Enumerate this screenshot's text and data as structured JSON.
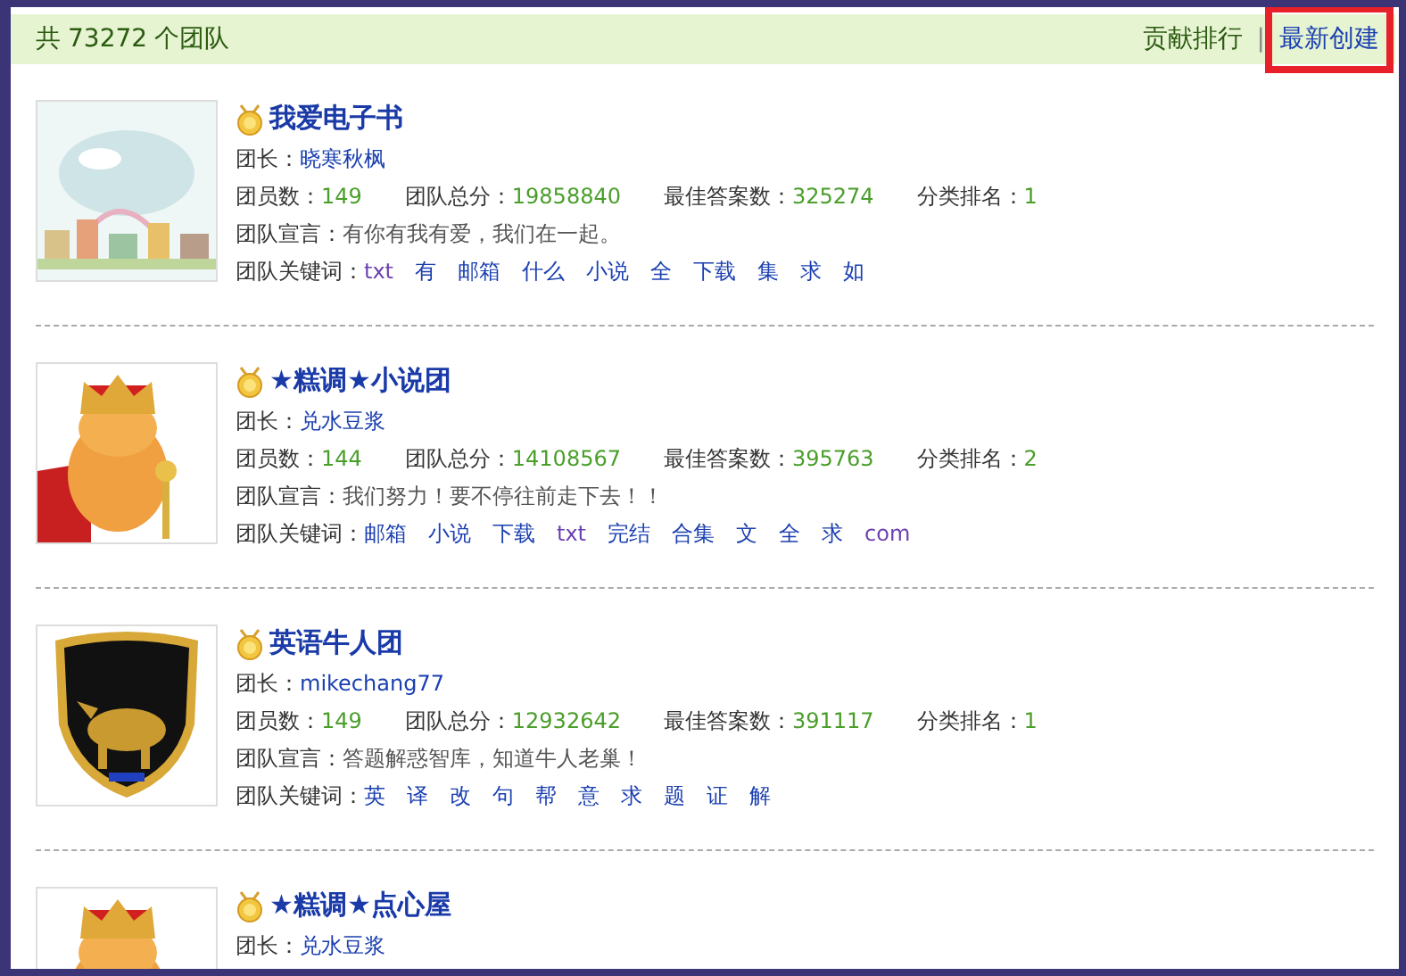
{
  "header": {
    "total_prefix": "共",
    "total_count": "73272",
    "total_suffix": "个团队",
    "sort_links": [
      {
        "label": "贡献排行",
        "selected": false,
        "highlighted": false
      },
      {
        "label": "最新创建",
        "selected": true,
        "highlighted": true
      }
    ],
    "separator": "|"
  },
  "teams": [
    {
      "name": "我爱电子书",
      "leader_label": "团长：",
      "leader": "晓寒秋枫",
      "stats": [
        {
          "label": "团员数：",
          "value": "149"
        },
        {
          "label": "团队总分：",
          "value": "19858840"
        },
        {
          "label": "最佳答案数：",
          "value": "325274"
        },
        {
          "label": "分类排名：",
          "value": "1"
        }
      ],
      "declaration_label": "团队宣言：",
      "declaration": "有你有我有爱，我们在一起。",
      "keywords_label": "团队关键词：",
      "keywords": [
        {
          "text": "txt",
          "visited": true
        },
        {
          "text": "有",
          "visited": false
        },
        {
          "text": "邮箱",
          "visited": false
        },
        {
          "text": "什么",
          "visited": false
        },
        {
          "text": "小说",
          "visited": false
        },
        {
          "text": "全",
          "visited": false
        },
        {
          "text": "下载",
          "visited": false
        },
        {
          "text": "集",
          "visited": false
        },
        {
          "text": "求",
          "visited": false
        },
        {
          "text": "如",
          "visited": false
        }
      ]
    },
    {
      "name": "★糕调★小说团",
      "leader_label": "团长：",
      "leader": "兑水豆浆",
      "stats": [
        {
          "label": "团员数：",
          "value": "144"
        },
        {
          "label": "团队总分：",
          "value": "14108567"
        },
        {
          "label": "最佳答案数：",
          "value": "395763"
        },
        {
          "label": "分类排名：",
          "value": "2"
        }
      ],
      "declaration_label": "团队宣言：",
      "declaration": "我们努力！要不停往前走下去！！",
      "keywords_label": "团队关键词：",
      "keywords": [
        {
          "text": "邮箱",
          "visited": false
        },
        {
          "text": "小说",
          "visited": false
        },
        {
          "text": "下载",
          "visited": false
        },
        {
          "text": "txt",
          "visited": true
        },
        {
          "text": "完结",
          "visited": false
        },
        {
          "text": "合集",
          "visited": false
        },
        {
          "text": "文",
          "visited": false
        },
        {
          "text": "全",
          "visited": false
        },
        {
          "text": "求",
          "visited": false
        },
        {
          "text": "com",
          "visited": true
        }
      ]
    },
    {
      "name": "英语牛人团",
      "leader_label": "团长：",
      "leader": "mikechang77",
      "stats": [
        {
          "label": "团员数：",
          "value": "149"
        },
        {
          "label": "团队总分：",
          "value": "12932642"
        },
        {
          "label": "最佳答案数：",
          "value": "391117"
        },
        {
          "label": "分类排名：",
          "value": "1"
        }
      ],
      "declaration_label": "团队宣言：",
      "declaration": "答题解惑智库，知道牛人老巢！",
      "keywords_label": "团队关键词：",
      "keywords": [
        {
          "text": "英",
          "visited": false
        },
        {
          "text": "译",
          "visited": false
        },
        {
          "text": "改",
          "visited": false
        },
        {
          "text": "句",
          "visited": false
        },
        {
          "text": "帮",
          "visited": false
        },
        {
          "text": "意",
          "visited": false
        },
        {
          "text": "求",
          "visited": false
        },
        {
          "text": "题",
          "visited": false
        },
        {
          "text": "证",
          "visited": false
        },
        {
          "text": "解",
          "visited": false
        }
      ]
    },
    {
      "name": "★糕调★点心屋",
      "leader_label": "团长：",
      "leader": "兑水豆浆"
    }
  ]
}
